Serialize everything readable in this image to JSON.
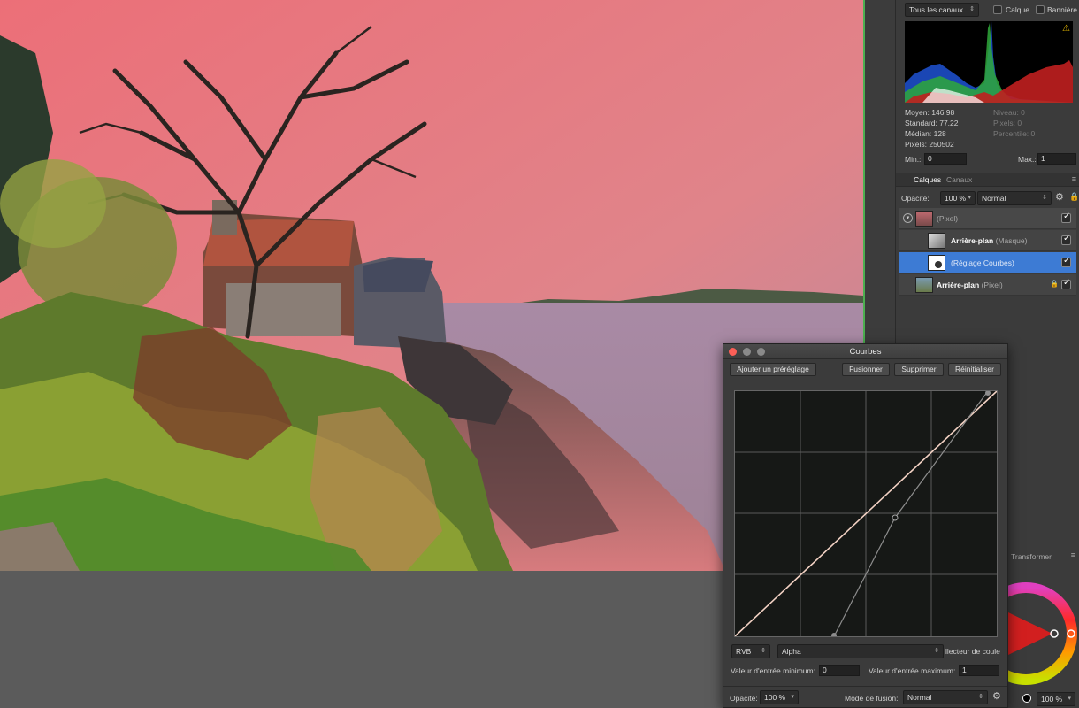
{
  "histogram_panel": {
    "channel_select": "Tous les canaux",
    "calque_label": "Calque",
    "banniere_label": "Bannière",
    "stats_left": [
      "Moyen: 146.98",
      "Standard: 77.22",
      "Médian: 128",
      "Pixels: 250502"
    ],
    "stats_right": [
      "Niveau: 0",
      "Pixels: 0",
      "Percentile: 0"
    ],
    "min_label": "Min.:",
    "min_value": "0",
    "max_label": "Max.:",
    "max_value": "1"
  },
  "layers_panel": {
    "tabs": [
      "Calques",
      "Canaux"
    ],
    "opacity_label": "Opacité:",
    "opacity_value": "100 %",
    "blend_mode": "Normal",
    "layers": [
      {
        "name": "",
        "sub": "(Pixel)"
      },
      {
        "name": "Arrière-plan",
        "sub": "(Masque)"
      },
      {
        "name": "",
        "sub": "(Réglage Courbes)"
      },
      {
        "name": "Arrière-plan",
        "sub": "(Pixel)"
      }
    ]
  },
  "curves_dialog": {
    "title": "Courbes",
    "add_preset": "Ajouter un préréglage",
    "merge": "Fusionner",
    "delete": "Supprimer",
    "reset": "Réinitialiser",
    "color_space": "RVB",
    "channel": "Alpha",
    "picker_label": "llecteur de coule",
    "input_min_label": "Valeur d'entrée minimum:",
    "input_min_value": "0",
    "input_max_label": "Valeur d'entrée maximum:",
    "input_max_value": "1",
    "opacity_label": "Opacité:",
    "opacity_value": "100 %",
    "blend_label": "Mode de fusion:",
    "blend_value": "Normal"
  },
  "side_fragment": {
    "transform_tab": "Transformer",
    "zoom_value": "100 %"
  },
  "colors": {
    "selection": "#3d7bd4",
    "doc_edge": "#4caf50",
    "sky": "#ec7d80"
  }
}
